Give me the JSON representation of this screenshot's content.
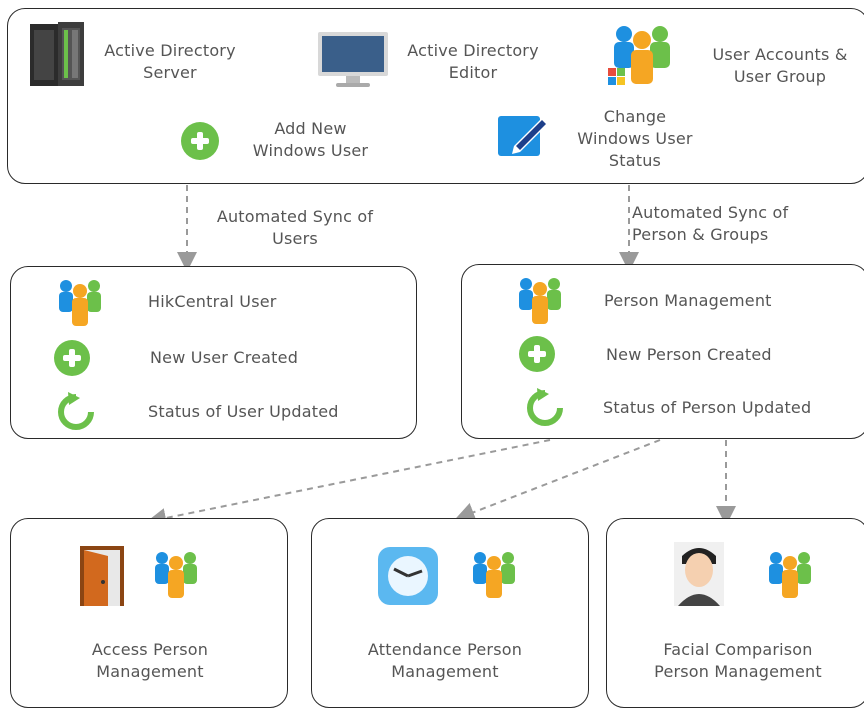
{
  "top": {
    "ad_server": "Active Directory\nServer",
    "ad_editor": "Active Directory\nEditor",
    "user_accounts": "User Accounts &\nUser Group",
    "add_windows_user": "Add New\nWindows User",
    "change_status": "Change\nWindows User\nStatus"
  },
  "sync": {
    "users": "Automated Sync of\nUsers",
    "person_groups": "Automated Sync of\nPerson & Groups"
  },
  "hik": {
    "user": "HikCentral User",
    "created": "New User Created",
    "updated": "Status of User Updated"
  },
  "person": {
    "management": "Person Management",
    "created": "New Person Created",
    "updated": "Status of Person Updated"
  },
  "bottom": {
    "access": "Access Person\nManagement",
    "attendance": "Attendance Person\nManagement",
    "facial": "Facial Comparison\nPerson Management"
  },
  "colors": {
    "border": "#2a2a2a",
    "arrow": "#9a9a9a",
    "green": "#6cc04a",
    "blue": "#1e90e0",
    "orange": "#f5a623"
  }
}
